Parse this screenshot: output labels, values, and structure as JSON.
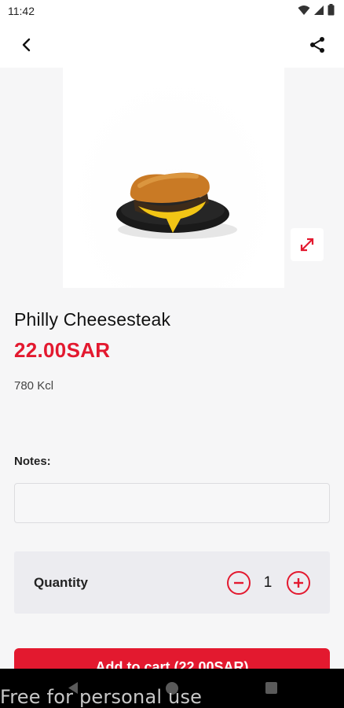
{
  "status_bar": {
    "time": "11:42",
    "icons": [
      "wifi-icon",
      "signal-icon",
      "battery-icon"
    ]
  },
  "app_bar": {
    "back_icon": "chevron-left-icon",
    "share_icon": "share-icon"
  },
  "product": {
    "image": "philly-cheesesteak-sandwich-photo",
    "expand_icon": "expand-arrows-icon",
    "name": "Philly Cheesesteak",
    "price": "22.00SAR",
    "calories": "780 Kcl"
  },
  "notes": {
    "label": "Notes:",
    "value": "",
    "placeholder": ""
  },
  "quantity": {
    "label": "Quantity",
    "value": "1",
    "minus_icon": "minus-circle-icon",
    "plus_icon": "plus-circle-icon"
  },
  "cart_button": {
    "label": "Add to cart (22.00SAR)"
  },
  "nav_bar": {
    "back_icon": "nav-back-icon",
    "home_icon": "nav-home-icon",
    "recent_icon": "nav-recent-icon"
  },
  "watermark": "Free for personal use",
  "colors": {
    "accent": "#e3192f",
    "background": "#f6f6f7",
    "panel": "#ececf0"
  }
}
